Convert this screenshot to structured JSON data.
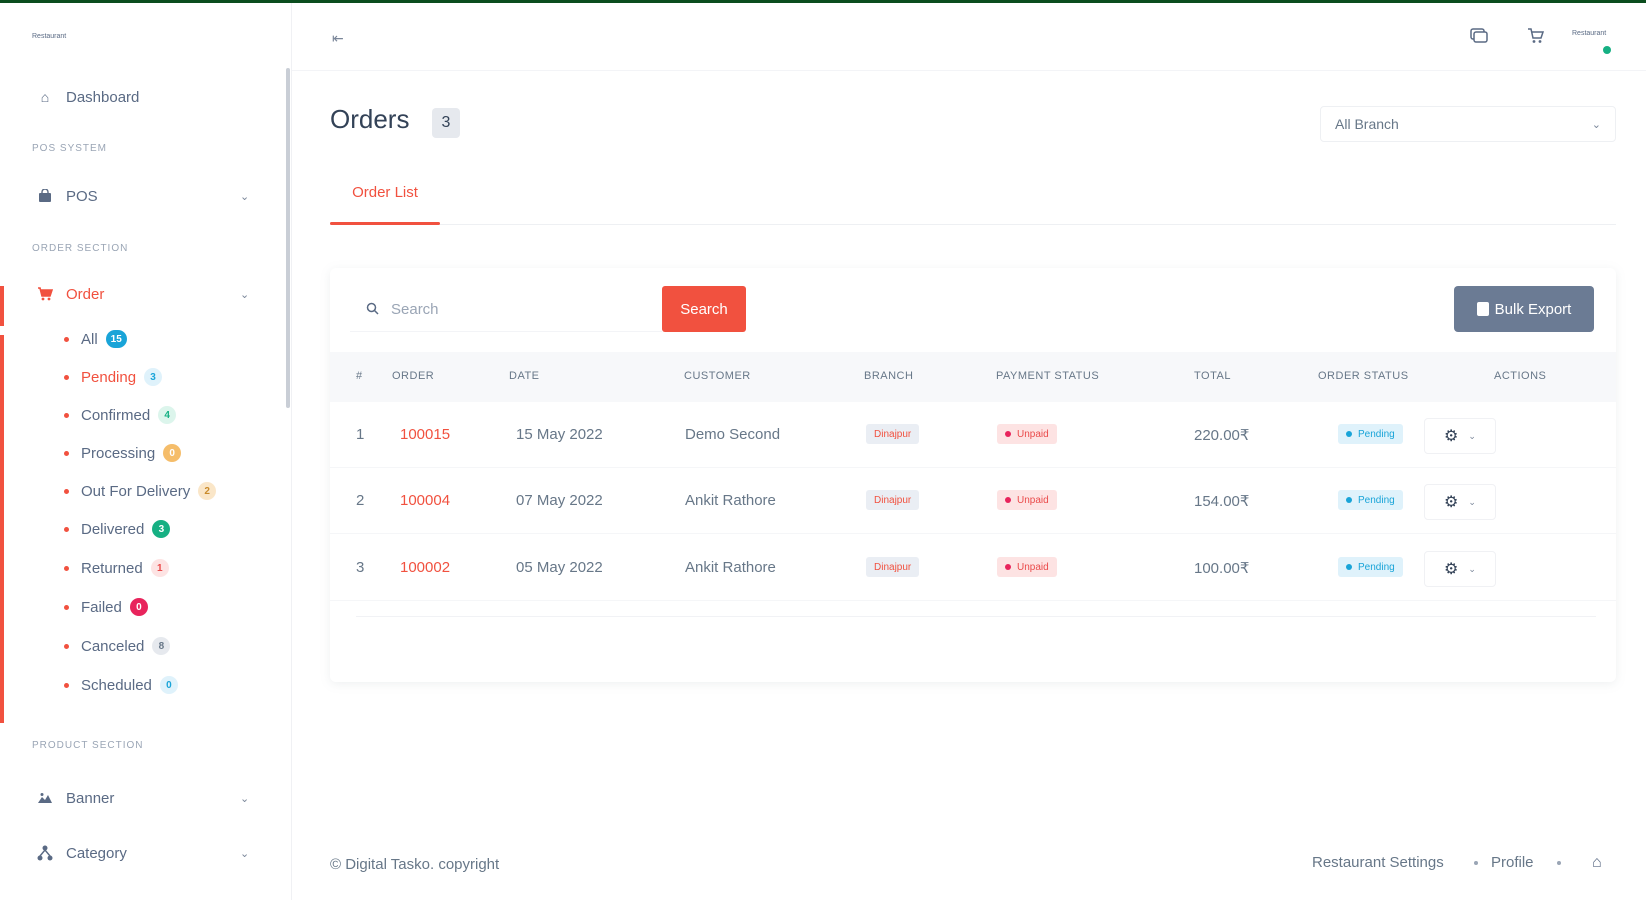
{
  "brand": {
    "text": "Restaurant"
  },
  "header": {
    "user_name": "Restaurant",
    "colors": {
      "accent": "#f1513f",
      "online": "#16b083"
    }
  },
  "sidebar": {
    "dashboard": "Dashboard",
    "section_pos": "POS SYSTEM",
    "pos": "POS",
    "section_order": "ORDER SECTION",
    "order": "Order",
    "order_items": [
      {
        "label": "All",
        "count": "15"
      },
      {
        "label": "Pending",
        "count": "3"
      },
      {
        "label": "Confirmed",
        "count": "4"
      },
      {
        "label": "Processing",
        "count": "0"
      },
      {
        "label": "Out For Delivery",
        "count": "2"
      },
      {
        "label": "Delivered",
        "count": "3"
      },
      {
        "label": "Returned",
        "count": "1"
      },
      {
        "label": "Failed",
        "count": "0"
      },
      {
        "label": "Canceled",
        "count": "8"
      },
      {
        "label": "Scheduled",
        "count": "0"
      }
    ],
    "section_product": "PRODUCT SECTION",
    "banner": "Banner",
    "category": "Category"
  },
  "page": {
    "title": "Orders",
    "count": "3",
    "branch_select": "All Branch",
    "tab": "Order List"
  },
  "toolbar": {
    "search_placeholder": "Search",
    "search_button": "Search",
    "export_button": "Bulk Export"
  },
  "table": {
    "headers": [
      "#",
      "ORDER",
      "DATE",
      "CUSTOMER",
      "BRANCH",
      "PAYMENT STATUS",
      "TOTAL",
      "ORDER STATUS",
      "ACTIONS"
    ],
    "rows": [
      {
        "sl": "1",
        "order": "100015",
        "date": "15 May 2022",
        "customer": "Demo Second",
        "branch": "Dinajpur",
        "payment": "Unpaid",
        "total": "220.00₹",
        "status": "Pending"
      },
      {
        "sl": "2",
        "order": "100004",
        "date": "07 May 2022",
        "customer": "Ankit Rathore",
        "branch": "Dinajpur",
        "payment": "Unpaid",
        "total": "154.00₹",
        "status": "Pending"
      },
      {
        "sl": "3",
        "order": "100002",
        "date": "05 May 2022",
        "customer": "Ankit Rathore",
        "branch": "Dinajpur",
        "payment": "Unpaid",
        "total": "100.00₹",
        "status": "Pending"
      }
    ]
  },
  "footer": {
    "copyright": "© Digital Tasko. copyright",
    "link_settings": "Restaurant Settings",
    "link_profile": "Profile"
  }
}
